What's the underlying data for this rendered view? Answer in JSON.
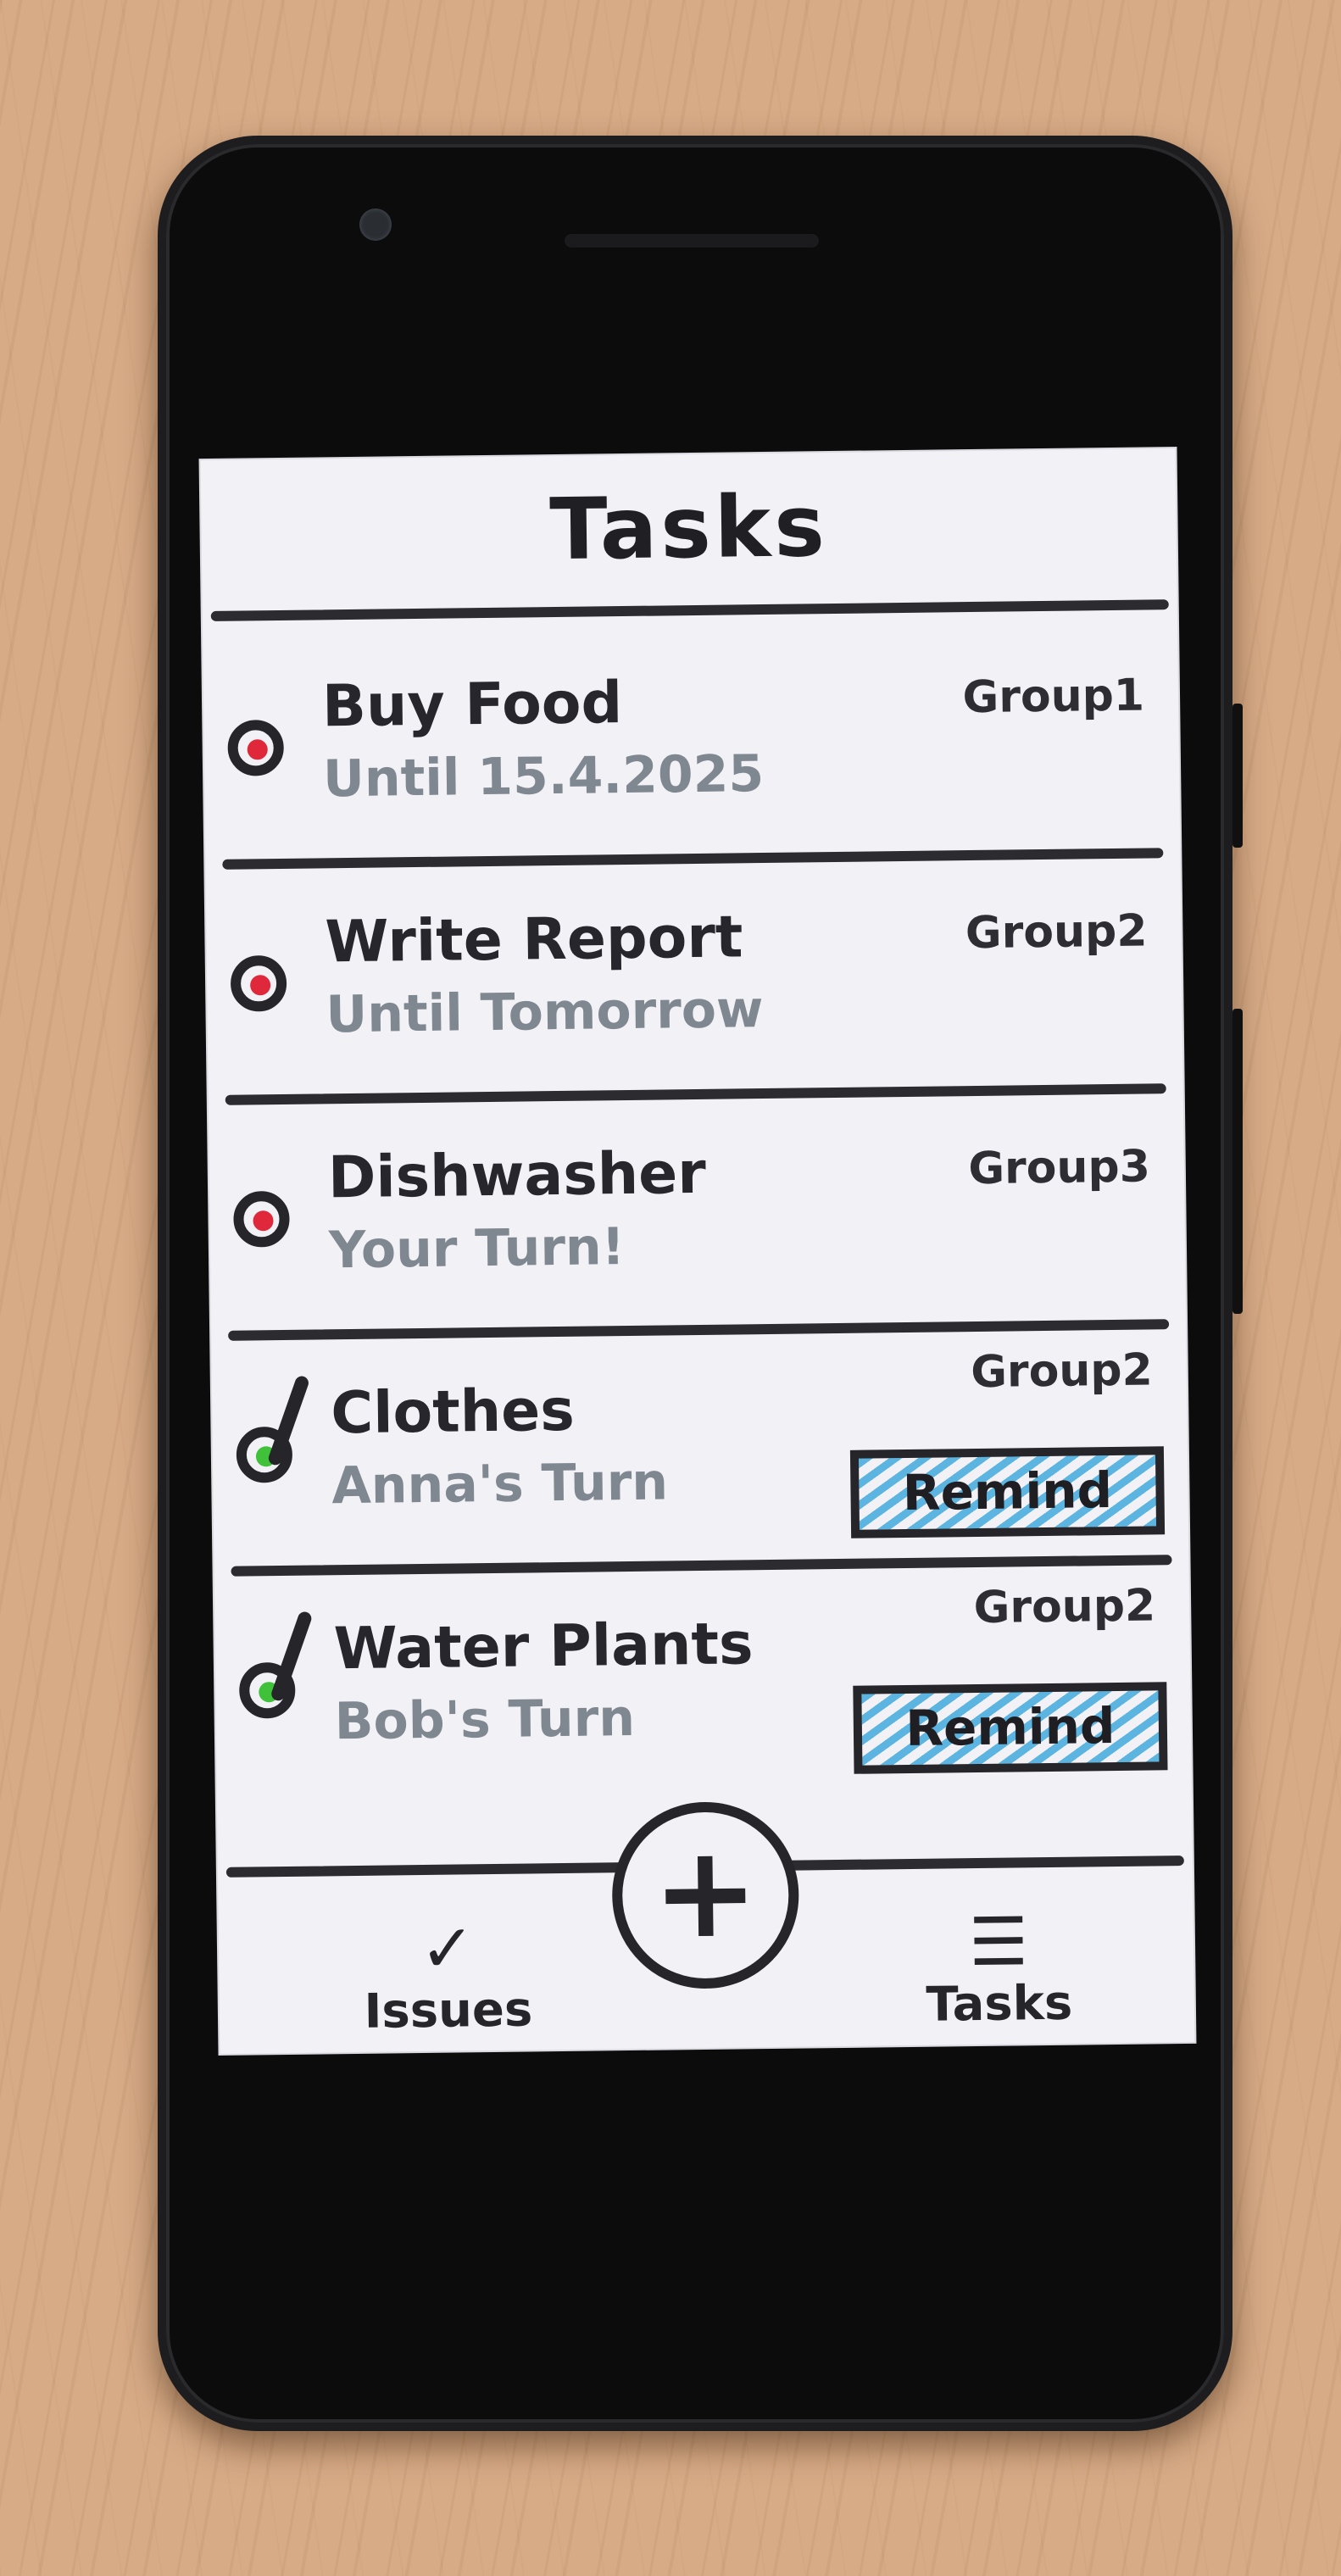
{
  "header": {
    "title": "Tasks"
  },
  "tasks": [
    {
      "title": "Buy Food",
      "subtitle": "Until 15.4.2025",
      "group": "Group1",
      "status_color": "#e0283b",
      "done": false
    },
    {
      "title": "Write Report",
      "subtitle": "Until Tomorrow",
      "group": "Group2",
      "status_color": "#e0283b",
      "done": false
    },
    {
      "title": "Dishwasher",
      "subtitle": "Your Turn!",
      "group": "Group3",
      "status_color": "#e0283b",
      "done": false
    },
    {
      "title": "Clothes",
      "subtitle": "Anna's Turn",
      "group": "Group2",
      "status_color": "#3fc23a",
      "done": true,
      "action_label": "Remind"
    },
    {
      "title": "Water Plants",
      "subtitle": "Bob's Turn",
      "group": "Group2",
      "status_color": "#3fc23a",
      "done": true,
      "action_label": "Remind"
    }
  ],
  "bottom_nav": {
    "issues_label": "Issues",
    "issues_icon": "✓",
    "add_icon": "+",
    "tasks_label": "Tasks",
    "tasks_icon": "☰"
  }
}
